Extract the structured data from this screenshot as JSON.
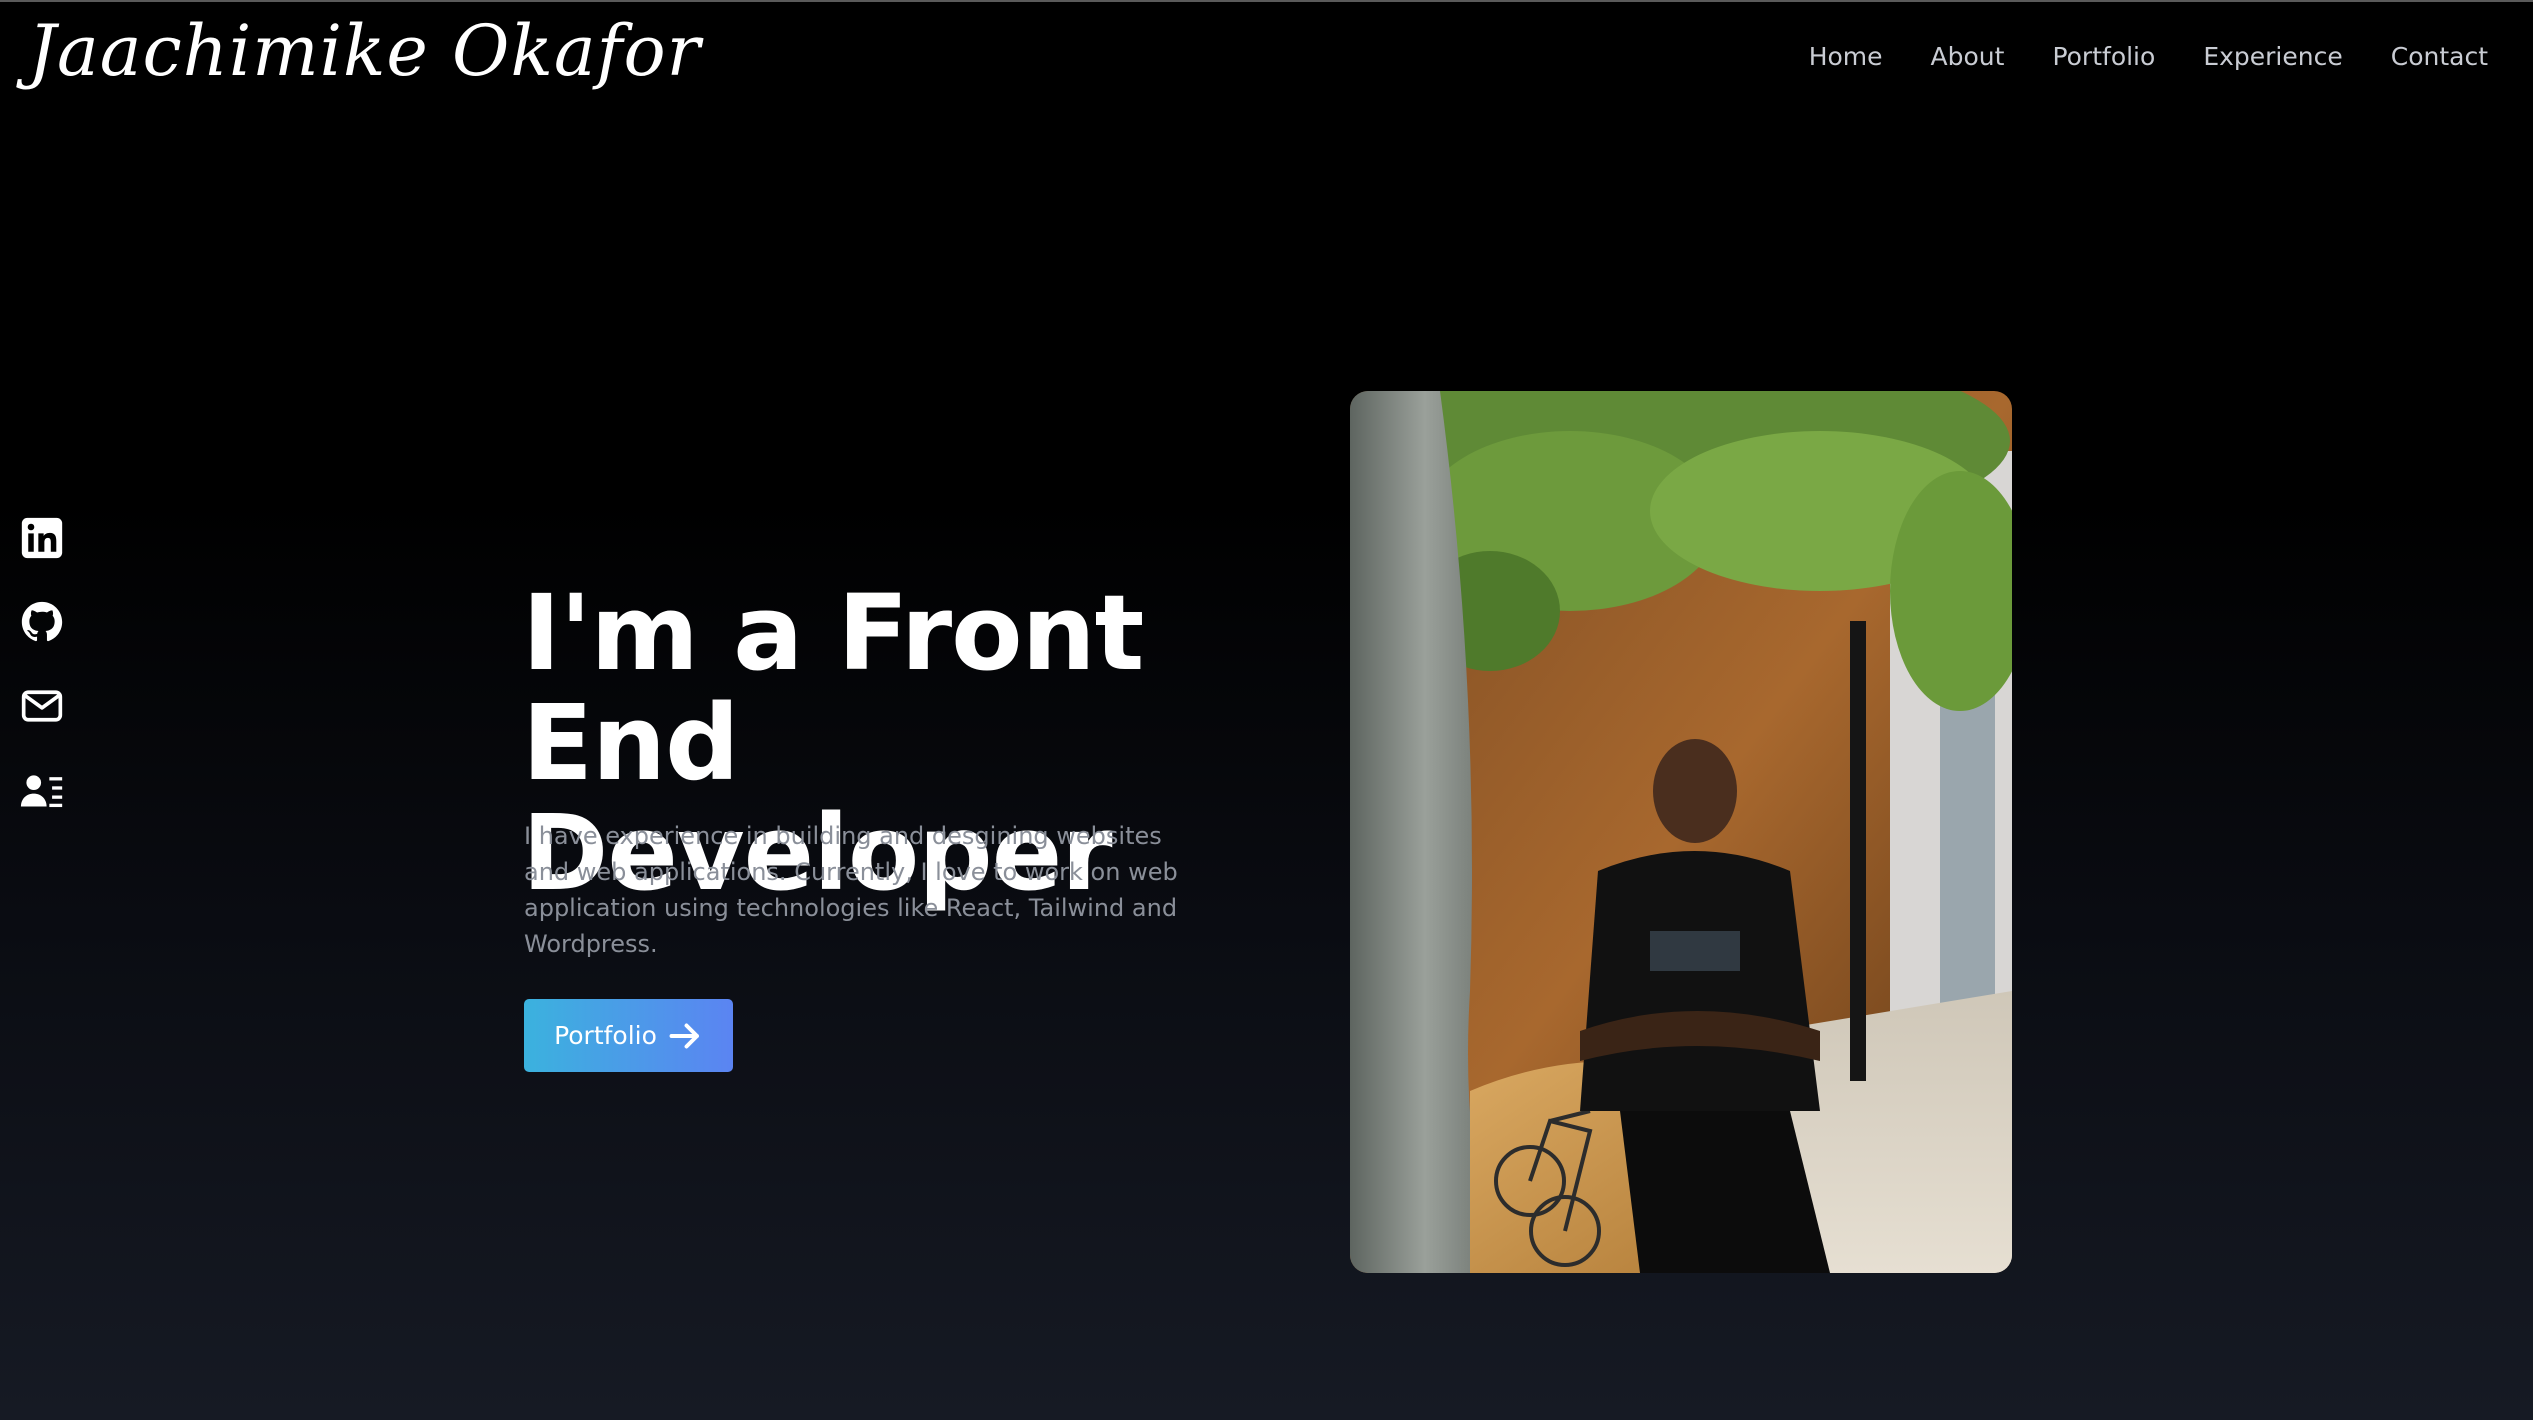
{
  "brand": {
    "name": "Jaachimike Okafor"
  },
  "nav": {
    "items": [
      {
        "label": "Home"
      },
      {
        "label": "About"
      },
      {
        "label": "Portfolio"
      },
      {
        "label": "Experience"
      },
      {
        "label": "Contact"
      }
    ]
  },
  "social": {
    "icons": [
      "linkedin-icon",
      "github-icon",
      "mail-icon",
      "resume-icon"
    ]
  },
  "hero": {
    "title_line1": "I'm a Front End",
    "title_line2": "Developer",
    "description": "I have experience in building and desgining websites and web applications. Currently, I love to work on web application using technologies like React, Tailwind and Wordpress.",
    "cta_label": "Portfolio",
    "cta_icon": "arrow-right-icon"
  },
  "colors": {
    "background": "#000000",
    "nav_text": "#c9ccd3",
    "description_text": "#8a8f99",
    "cta_gradient_start": "#3bb2de",
    "cta_gradient_end": "#5b84f2"
  }
}
